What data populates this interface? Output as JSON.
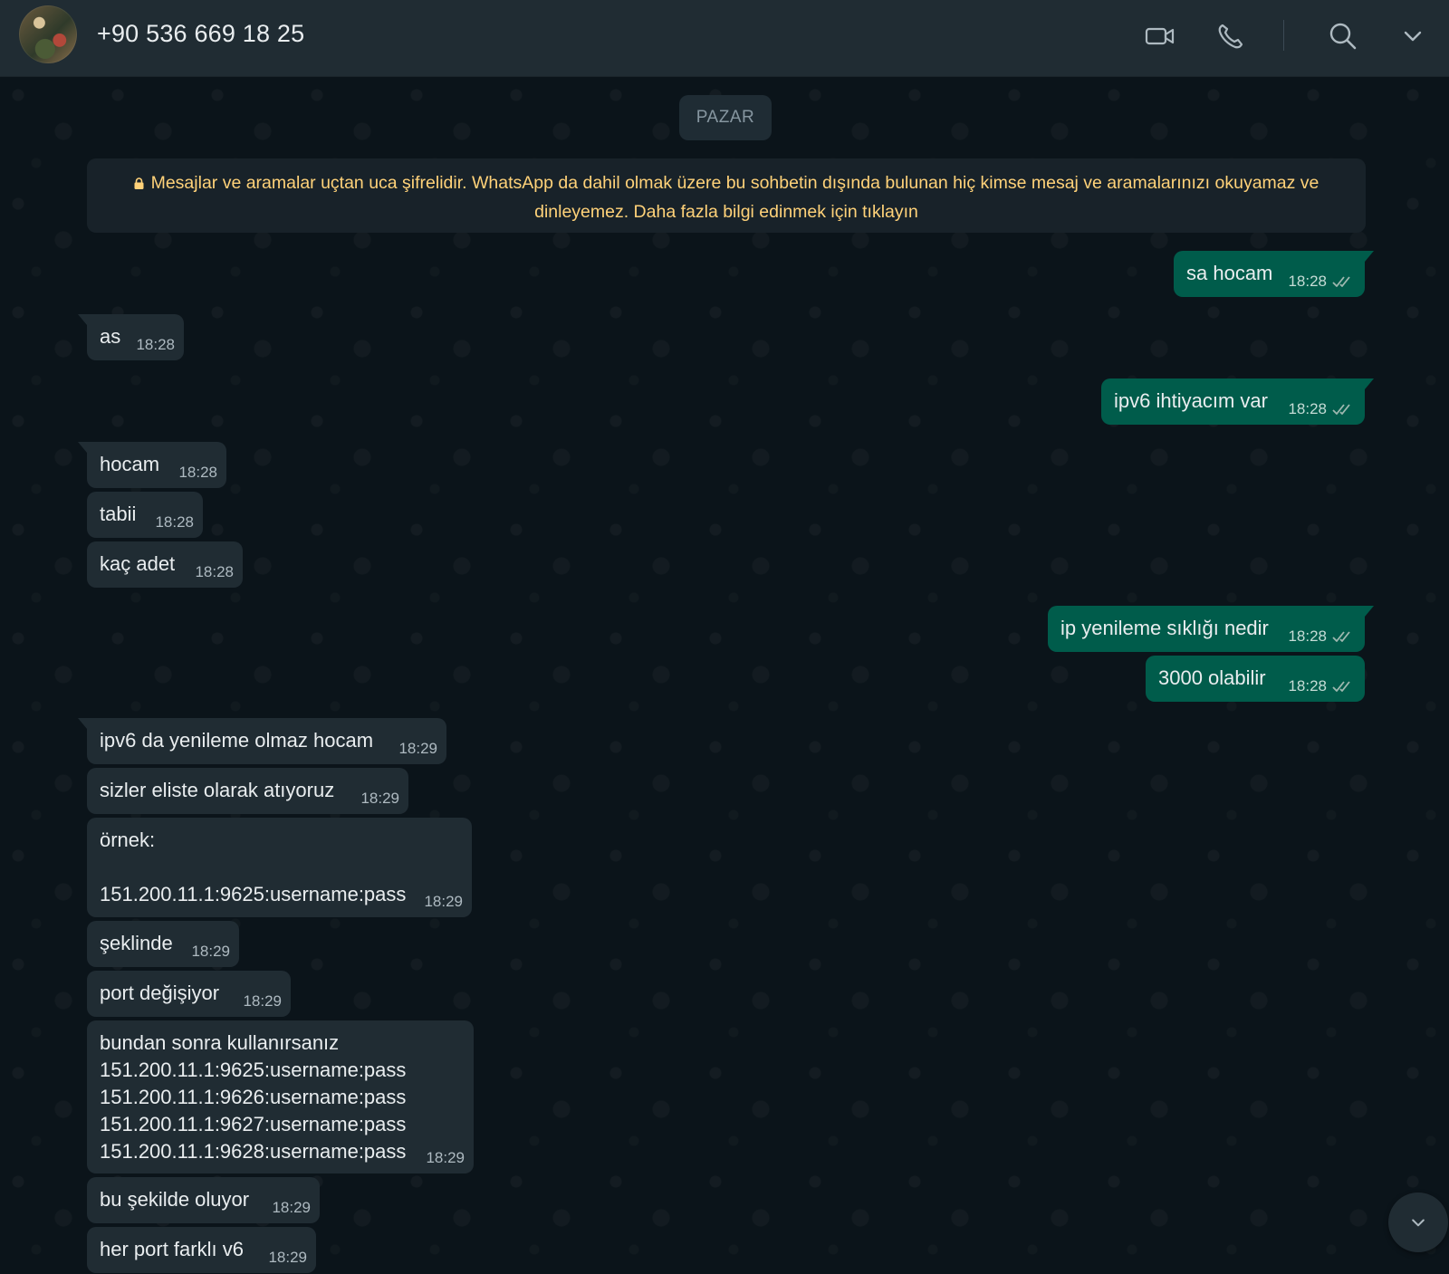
{
  "header": {
    "contact_name": "+90 536 669 18 25",
    "icons": [
      "video-call-icon",
      "voice-call-icon",
      "search-icon",
      "chevron-down-icon"
    ]
  },
  "chat": {
    "day_label": "PAZAR",
    "encryption_notice": "Mesajlar ve aramalar uçtan uca şifrelidir. WhatsApp da dahil olmak üzere bu sohbetin dışında bulunan hiç kimse mesaj ve aramalarınızı okuyamaz ve dinleyemez. Daha fazla bilgi edinmek için tıklayın",
    "messages": [
      {
        "dir": "out",
        "text": "sa hocam",
        "time": "18:28",
        "status": "read"
      },
      {
        "dir": "in",
        "text": "as",
        "time": "18:28"
      },
      {
        "dir": "out",
        "text": "ipv6 ihtiyacım var",
        "time": "18:28",
        "status": "read"
      },
      {
        "dir": "in",
        "text": "hocam",
        "time": "18:28"
      },
      {
        "dir": "in",
        "text": "tabii",
        "time": "18:28"
      },
      {
        "dir": "in",
        "text": "kaç adet",
        "time": "18:28"
      },
      {
        "dir": "out",
        "text": "ip yenileme sıklığı nedir",
        "time": "18:28",
        "status": "read"
      },
      {
        "dir": "out",
        "text": "3000 olabilir",
        "time": "18:28",
        "status": "read"
      },
      {
        "dir": "in",
        "text": "ipv6 da yenileme olmaz hocam",
        "time": "18:29"
      },
      {
        "dir": "in",
        "text": "sizler eliste olarak atıyoruz",
        "time": "18:29"
      },
      {
        "dir": "in",
        "text": "örnek:\n\n151.200.11.1:9625:username:pass",
        "time": "18:29"
      },
      {
        "dir": "in",
        "text": "şeklinde",
        "time": "18:29"
      },
      {
        "dir": "in",
        "text": "port değişiyor",
        "time": "18:29"
      },
      {
        "dir": "in",
        "text": "bundan sonra kullanırsanız\n151.200.11.1:9625:username:pass\n151.200.11.1:9626:username:pass\n151.200.11.1:9627:username:pass\n151.200.11.1:9628:username:pass",
        "time": "18:29"
      },
      {
        "dir": "in",
        "text": "bu şekilde oluyor",
        "time": "18:29"
      },
      {
        "dir": "in",
        "text": "her port farklı v6",
        "time": "18:29"
      }
    ]
  },
  "colors": {
    "header_bg": "#202c33",
    "chat_bg": "#0b141a",
    "incoming_bubble": "#202c33",
    "outgoing_bubble": "#005c4b",
    "notice_text": "#ffd279",
    "read_tick": "#9fb8b0"
  }
}
